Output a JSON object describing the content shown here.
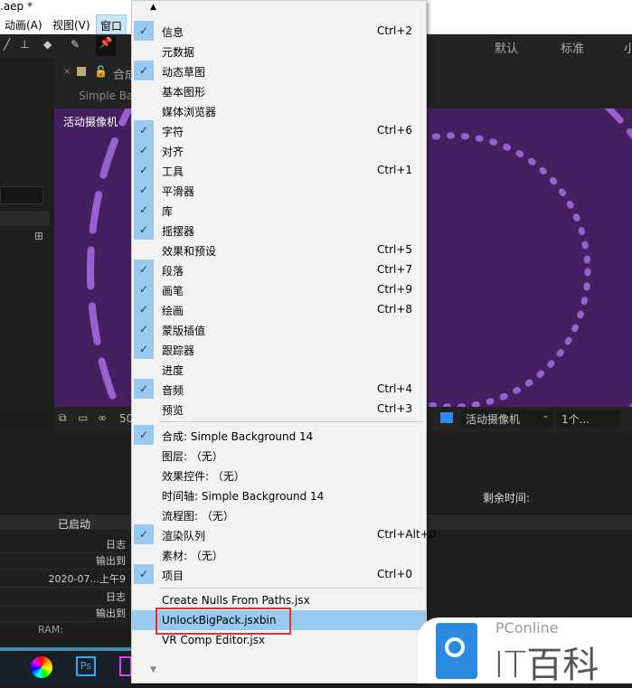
{
  "title": ".aep *",
  "menubar": [
    "动画(A)",
    "视图(V)",
    "窗口"
  ],
  "workspaces": [
    "默认",
    "标准",
    "小"
  ],
  "comp": {
    "tab": "合成",
    "subtab": "Simple Bac",
    "camera_label": "活动摄像机",
    "zoom": "50",
    "view_camera": "活动摄像机",
    "views": "1个..."
  },
  "render": {
    "status": "已启动",
    "remaining": "剩余时间:",
    "rows": [
      "日志",
      "输出到",
      "2020-07...上午9",
      "日志",
      "输出到"
    ],
    "ram": "RAM:"
  },
  "menu": {
    "top_arrow": "▲",
    "bottom_arrow": "▼",
    "group1": [
      {
        "label": "信息",
        "shortcut": "Ctrl+2",
        "checked": true
      },
      {
        "label": "元数据",
        "shortcut": "",
        "checked": false
      },
      {
        "label": "动态草图",
        "shortcut": "",
        "checked": true
      },
      {
        "label": "基本图形",
        "shortcut": "",
        "checked": false
      },
      {
        "label": "媒体浏览器",
        "shortcut": "",
        "checked": false
      },
      {
        "label": "字符",
        "shortcut": "Ctrl+6",
        "checked": true
      },
      {
        "label": "对齐",
        "shortcut": "",
        "checked": true
      },
      {
        "label": "工具",
        "shortcut": "Ctrl+1",
        "checked": true
      },
      {
        "label": "平滑器",
        "shortcut": "",
        "checked": true
      },
      {
        "label": "库",
        "shortcut": "",
        "checked": true
      },
      {
        "label": "摇摆器",
        "shortcut": "",
        "checked": true
      },
      {
        "label": "效果和预设",
        "shortcut": "Ctrl+5",
        "checked": false
      },
      {
        "label": "段落",
        "shortcut": "Ctrl+7",
        "checked": true
      },
      {
        "label": "画笔",
        "shortcut": "Ctrl+9",
        "checked": true
      },
      {
        "label": "绘画",
        "shortcut": "Ctrl+8",
        "checked": true
      },
      {
        "label": "蒙版插值",
        "shortcut": "",
        "checked": true
      },
      {
        "label": "跟踪器",
        "shortcut": "",
        "checked": true
      },
      {
        "label": "进度",
        "shortcut": "",
        "checked": false
      },
      {
        "label": "音频",
        "shortcut": "Ctrl+4",
        "checked": true
      },
      {
        "label": "预览",
        "shortcut": "Ctrl+3",
        "checked": false
      }
    ],
    "group2": [
      {
        "label": "合成: Simple Background 14",
        "shortcut": "",
        "checked": true
      },
      {
        "label": "图层: （无）",
        "shortcut": "",
        "checked": false
      },
      {
        "label": "效果控件: （无）",
        "shortcut": "",
        "checked": false
      },
      {
        "label": "时间轴: Simple Background 14",
        "shortcut": "",
        "checked": false
      },
      {
        "label": "流程图: （无）",
        "shortcut": "",
        "checked": false
      },
      {
        "label": "渲染队列",
        "shortcut": "Ctrl+Alt+0",
        "checked": true
      },
      {
        "label": "素材: （无）",
        "shortcut": "",
        "checked": false
      },
      {
        "label": "项目",
        "shortcut": "Ctrl+0",
        "checked": true
      }
    ],
    "group3": [
      {
        "label": "Create Nulls From Paths.jsx",
        "selected": false
      },
      {
        "label": "UnlockBigPack.jsxbin",
        "selected": true
      },
      {
        "label": "VR Comp Editor.jsx",
        "selected": false
      }
    ]
  },
  "watermark": {
    "brand": "PConline",
    "name": "IT百科"
  },
  "colors": {
    "check_bg": "#99c9ef",
    "highlight": "#e03030",
    "viewer": "#452060"
  }
}
